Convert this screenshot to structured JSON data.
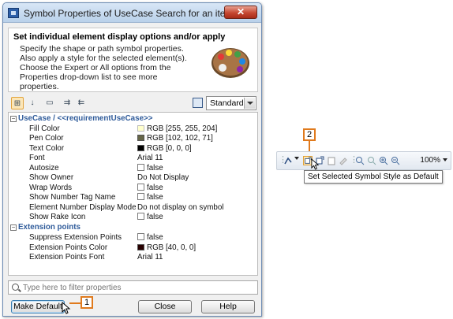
{
  "dialog": {
    "title": "Symbol Properties of UseCase Search for an item",
    "close_label": "✕",
    "header_title": "Set individual element display options and/or apply",
    "header_desc": "Specify the shape or path symbol properties. Also apply a style for the selected element(s). Choose the Expert or All options from the Properties drop-down list to see more properties.",
    "mode_select": "Standard",
    "filter_placeholder": "Type here to filter properties",
    "buttons": {
      "make_default": "Make Default",
      "close": "Close",
      "help": "Help"
    }
  },
  "properties": {
    "section1": "UseCase / <<requirementUseCase>>",
    "rows1": [
      {
        "k": "Fill Color",
        "v": "RGB [255, 255, 204]"
      },
      {
        "k": "Pen Color",
        "v": "RGB [102, 102, 71]"
      },
      {
        "k": "Text Color",
        "v": "RGB [0, 0, 0]"
      },
      {
        "k": "Font",
        "v": "Arial 11"
      },
      {
        "k": "Autosize",
        "v": "false"
      },
      {
        "k": "Show Owner",
        "v": "Do Not Display"
      },
      {
        "k": "Wrap Words",
        "v": "false"
      },
      {
        "k": "Show Number Tag Name",
        "v": "false"
      },
      {
        "k": "Element Number Display Mode",
        "v": "Do not display on symbol"
      },
      {
        "k": "Show Rake Icon",
        "v": "false"
      }
    ],
    "section2": "Extension points",
    "rows2": [
      {
        "k": "Suppress Extension Points",
        "v": "false"
      },
      {
        "k": "Extension Points Color",
        "v": "RGB [40, 0, 0]"
      },
      {
        "k": "Extension Points Font",
        "v": "Arial 11"
      }
    ]
  },
  "swatches": {
    "fill": "#ffffcc",
    "pen": "#666647",
    "text": "#000000",
    "ext": "#280000"
  },
  "callouts": {
    "one": "1",
    "two": "2"
  },
  "right_toolbar": {
    "zoom": "100%",
    "tooltip": "Set Selected Symbol Style as Default"
  },
  "accent": "#e07a1d"
}
